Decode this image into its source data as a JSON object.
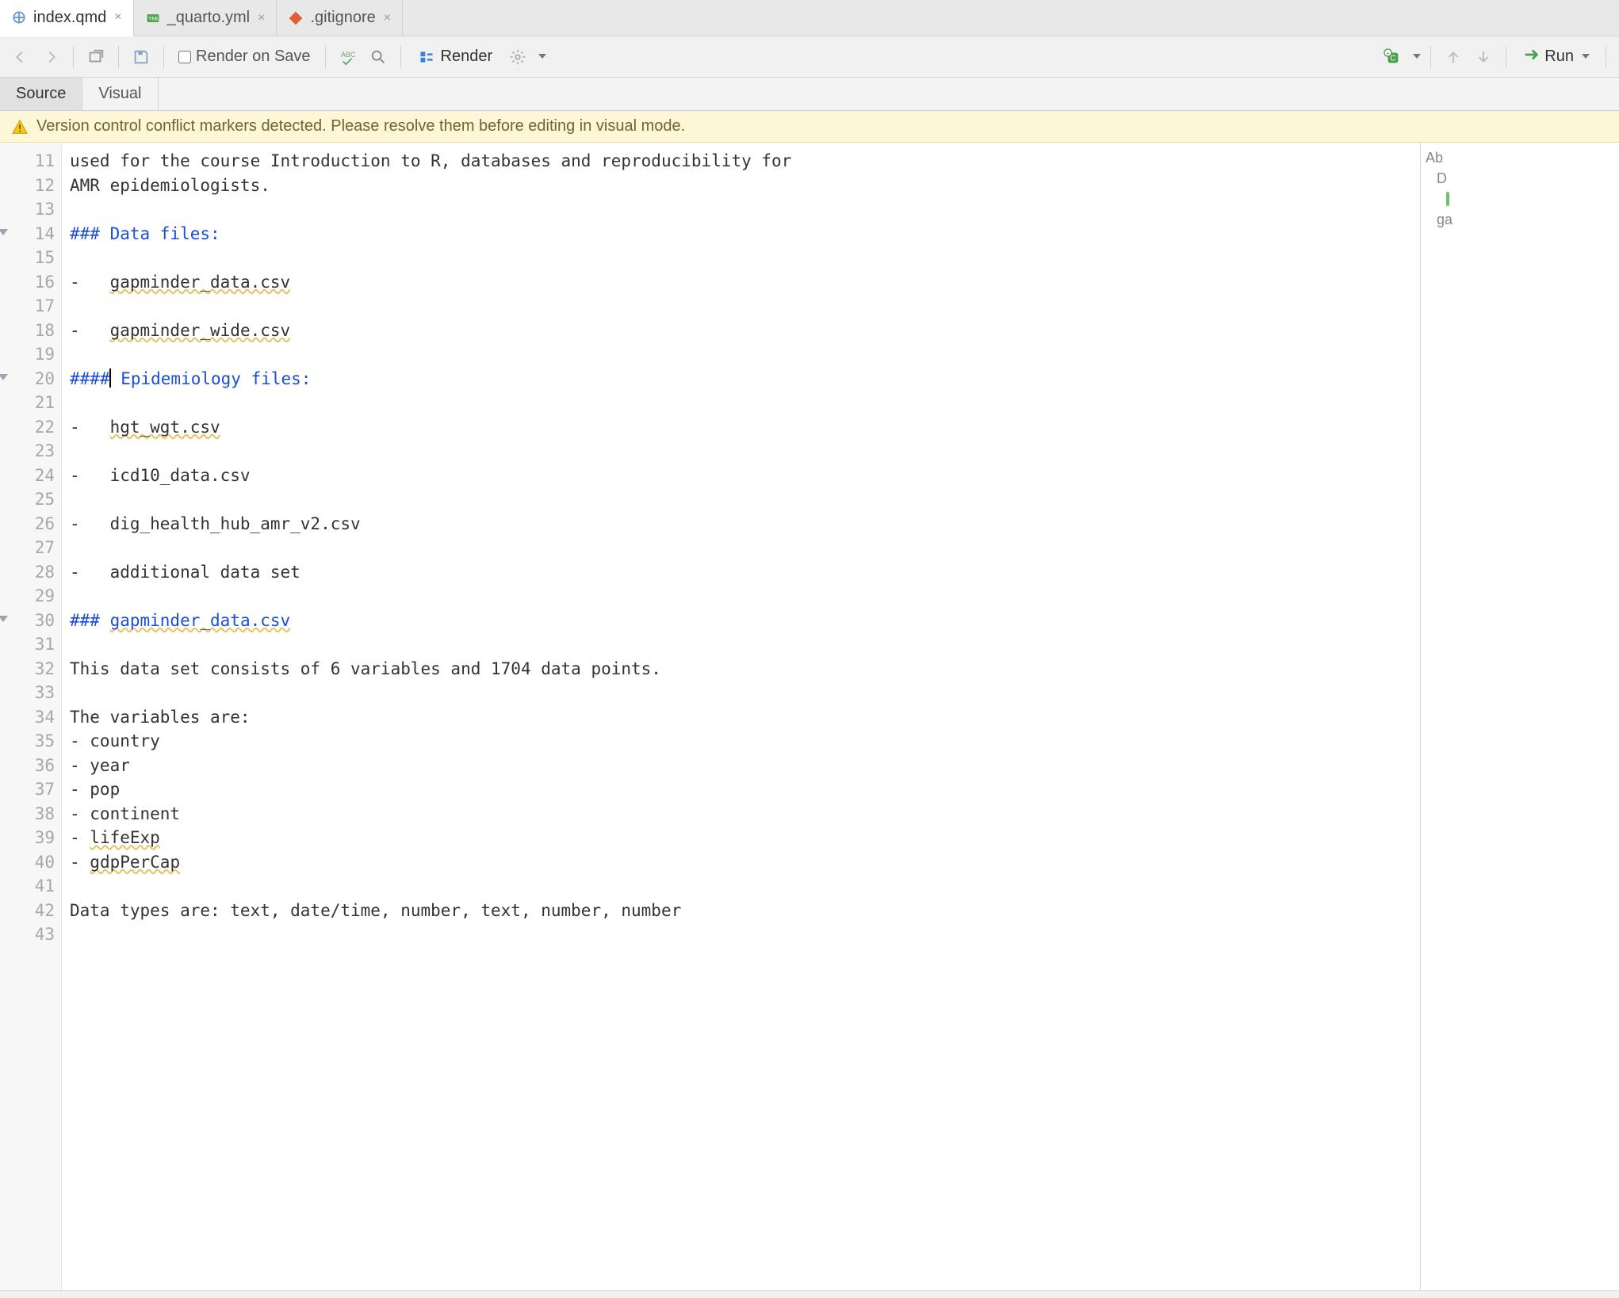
{
  "tabs": [
    {
      "label": "index.qmd",
      "active": true,
      "icon": "quarto"
    },
    {
      "label": "_quarto.yml",
      "active": false,
      "icon": "yml"
    },
    {
      "label": ".gitignore",
      "active": false,
      "icon": "git"
    }
  ],
  "toolbar": {
    "render_on_save_label": "Render on Save",
    "render_label": "Render",
    "run_label": "Run"
  },
  "mode_tabs": {
    "source": "Source",
    "visual": "Visual"
  },
  "banner": {
    "text": "Version control conflict markers detected. Please resolve them before editing in visual mode."
  },
  "cursor_line": 20,
  "lines": [
    {
      "n": 11,
      "type": "text",
      "text": "used for the course Introduction to R, databases and reproducibility for"
    },
    {
      "n": 12,
      "type": "text",
      "text": "AMR epidemiologists."
    },
    {
      "n": 13,
      "type": "blank"
    },
    {
      "n": 14,
      "type": "heading",
      "prefix": "### ",
      "title": "Data files:",
      "fold": true
    },
    {
      "n": 15,
      "type": "blank"
    },
    {
      "n": 16,
      "type": "list",
      "bullet": "-   ",
      "item": "gapminder_data.csv",
      "spell": true
    },
    {
      "n": 17,
      "type": "blank"
    },
    {
      "n": 18,
      "type": "list",
      "bullet": "-   ",
      "item": "gapminder_wide.csv",
      "spell": true
    },
    {
      "n": 19,
      "type": "blank"
    },
    {
      "n": 20,
      "type": "heading-cursor",
      "prefix": "####",
      "title": " Epidemiology files:",
      "fold": true
    },
    {
      "n": 21,
      "type": "blank"
    },
    {
      "n": 22,
      "type": "list",
      "bullet": "-   ",
      "item": "hgt_wgt.csv",
      "spell": true
    },
    {
      "n": 23,
      "type": "blank"
    },
    {
      "n": 24,
      "type": "list",
      "bullet": "-   ",
      "item": "icd10_data.csv"
    },
    {
      "n": 25,
      "type": "blank"
    },
    {
      "n": 26,
      "type": "list",
      "bullet": "-   ",
      "item": "dig_health_hub_amr_v2.csv"
    },
    {
      "n": 27,
      "type": "blank"
    },
    {
      "n": 28,
      "type": "list",
      "bullet": "-   ",
      "item": "additional data set"
    },
    {
      "n": 29,
      "type": "blank"
    },
    {
      "n": 30,
      "type": "heading",
      "prefix": "### ",
      "title": "gapminder_data.csv",
      "fold": true,
      "spell": true
    },
    {
      "n": 31,
      "type": "blank"
    },
    {
      "n": 32,
      "type": "text",
      "text": "This data set consists of 6 variables and 1704 data points."
    },
    {
      "n": 33,
      "type": "blank"
    },
    {
      "n": 34,
      "type": "text",
      "text": "The variables are:"
    },
    {
      "n": 35,
      "type": "text",
      "text": "- country"
    },
    {
      "n": 36,
      "type": "text",
      "text": "- year"
    },
    {
      "n": 37,
      "type": "text",
      "text": "- pop"
    },
    {
      "n": 38,
      "type": "text",
      "text": "- continent"
    },
    {
      "n": 39,
      "type": "text-spell",
      "text_a": "- ",
      "text_b": "lifeExp"
    },
    {
      "n": 40,
      "type": "text-spell",
      "text_a": "- ",
      "text_b": "gdpPerCap"
    },
    {
      "n": 41,
      "type": "blank"
    },
    {
      "n": 42,
      "type": "text",
      "text": "Data types are: text, date/time, number, text, number, number"
    },
    {
      "n": 43,
      "type": "blank"
    }
  ],
  "outline": [
    {
      "label": "Ab",
      "level": 1
    },
    {
      "label": "D",
      "level": 2
    },
    {
      "label": "",
      "level": 3,
      "mark": true
    },
    {
      "label": "ga",
      "level": 2
    }
  ]
}
